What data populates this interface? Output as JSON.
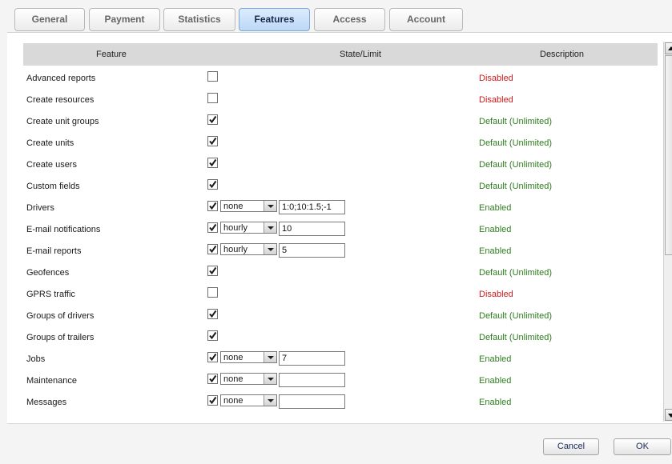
{
  "tabs": [
    {
      "label": "General"
    },
    {
      "label": "Payment"
    },
    {
      "label": "Statistics"
    },
    {
      "label": "Features"
    },
    {
      "label": "Access"
    },
    {
      "label": "Account"
    }
  ],
  "active_tab": "Features",
  "table": {
    "columns": {
      "feature": "Feature",
      "state": "State/Limit",
      "description": "Description"
    },
    "rows": [
      {
        "feature": "Advanced reports",
        "checked": false,
        "description": "Disabled"
      },
      {
        "feature": "Create resources",
        "checked": false,
        "description": "Disabled"
      },
      {
        "feature": "Create unit groups",
        "checked": true,
        "description": "Default (Unlimited)"
      },
      {
        "feature": "Create units",
        "checked": true,
        "description": "Default (Unlimited)"
      },
      {
        "feature": "Create users",
        "checked": true,
        "description": "Default (Unlimited)"
      },
      {
        "feature": "Custom fields",
        "checked": true,
        "description": "Default (Unlimited)"
      },
      {
        "feature": "Drivers",
        "checked": true,
        "period": "none",
        "limit": "1:0;10:1.5;-1",
        "description": "Enabled"
      },
      {
        "feature": "E-mail notifications",
        "checked": true,
        "period": "hourly",
        "limit": "10",
        "description": "Enabled"
      },
      {
        "feature": "E-mail reports",
        "checked": true,
        "period": "hourly",
        "limit": "5",
        "description": "Enabled"
      },
      {
        "feature": "Geofences",
        "checked": true,
        "description": "Default (Unlimited)"
      },
      {
        "feature": "GPRS traffic",
        "checked": false,
        "description": "Disabled"
      },
      {
        "feature": "Groups of drivers",
        "checked": true,
        "description": "Default (Unlimited)"
      },
      {
        "feature": "Groups of trailers",
        "checked": true,
        "description": "Default (Unlimited)"
      },
      {
        "feature": "Jobs",
        "checked": true,
        "period": "none",
        "limit": "7",
        "description": "Enabled"
      },
      {
        "feature": "Maintenance",
        "checked": true,
        "period": "none",
        "limit": "",
        "description": "Enabled"
      },
      {
        "feature": "Messages",
        "checked": true,
        "period": "none",
        "limit": "",
        "description": "Enabled"
      }
    ]
  },
  "colors": {
    "enabled": "#2e7d1f",
    "disabled": "#d11a1a",
    "active_tab": "#bcd7f5",
    "header": "#d9d9d9"
  },
  "buttons": {
    "cancel": "Cancel",
    "ok": "OK"
  }
}
